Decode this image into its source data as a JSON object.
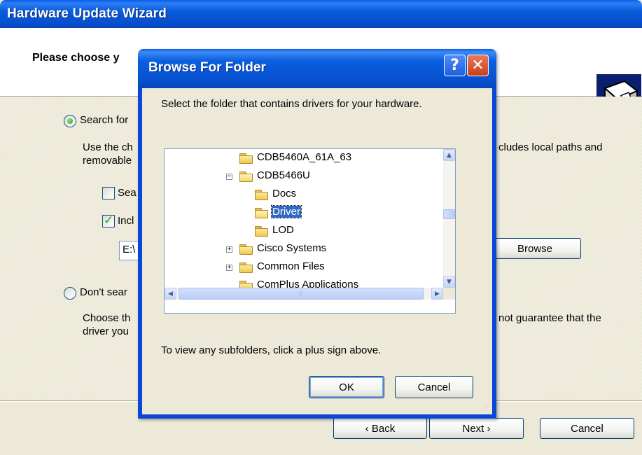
{
  "wizard": {
    "title": "Hardware Update Wizard",
    "header_text": "Please choose y",
    "search_option_label": "Search for",
    "search_desc_left_line1": "Use the ch",
    "search_desc_left_line2": "removable",
    "search_desc_right": "cludes local paths and",
    "search_removable_label": "Sea",
    "include_location_label": "Incl",
    "path_value": "E:\\",
    "browse_label": "Browse",
    "dont_search_label": "Don't sear",
    "choose_desc_left_line1": "Choose th",
    "choose_desc_left_line2": "driver you",
    "choose_desc_right": "not guarantee that the",
    "back_label": "‹ Back",
    "next_label": "Next ›",
    "cancel_label": "Cancel"
  },
  "dialog": {
    "title": "Browse For Folder",
    "help_glyph": "?",
    "close_glyph": "✕",
    "instruction": "Select the folder that contains drivers for your hardware.",
    "hint": "To view any subfolders, click a plus sign above.",
    "ok_label": "OK",
    "cancel_label": "Cancel",
    "tree": [
      {
        "label": "CDB5460A_61A_63",
        "expander": ""
      },
      {
        "label": "CDB5466U",
        "expander": "−"
      },
      {
        "label": "Docs",
        "expander": ""
      },
      {
        "label": "Driver",
        "expander": "",
        "selected": true
      },
      {
        "label": "LOD",
        "expander": ""
      },
      {
        "label": "Cisco Systems",
        "expander": "+"
      },
      {
        "label": "Common Files",
        "expander": "+"
      },
      {
        "label": "ComPlus Applications",
        "expander": ""
      }
    ]
  }
}
